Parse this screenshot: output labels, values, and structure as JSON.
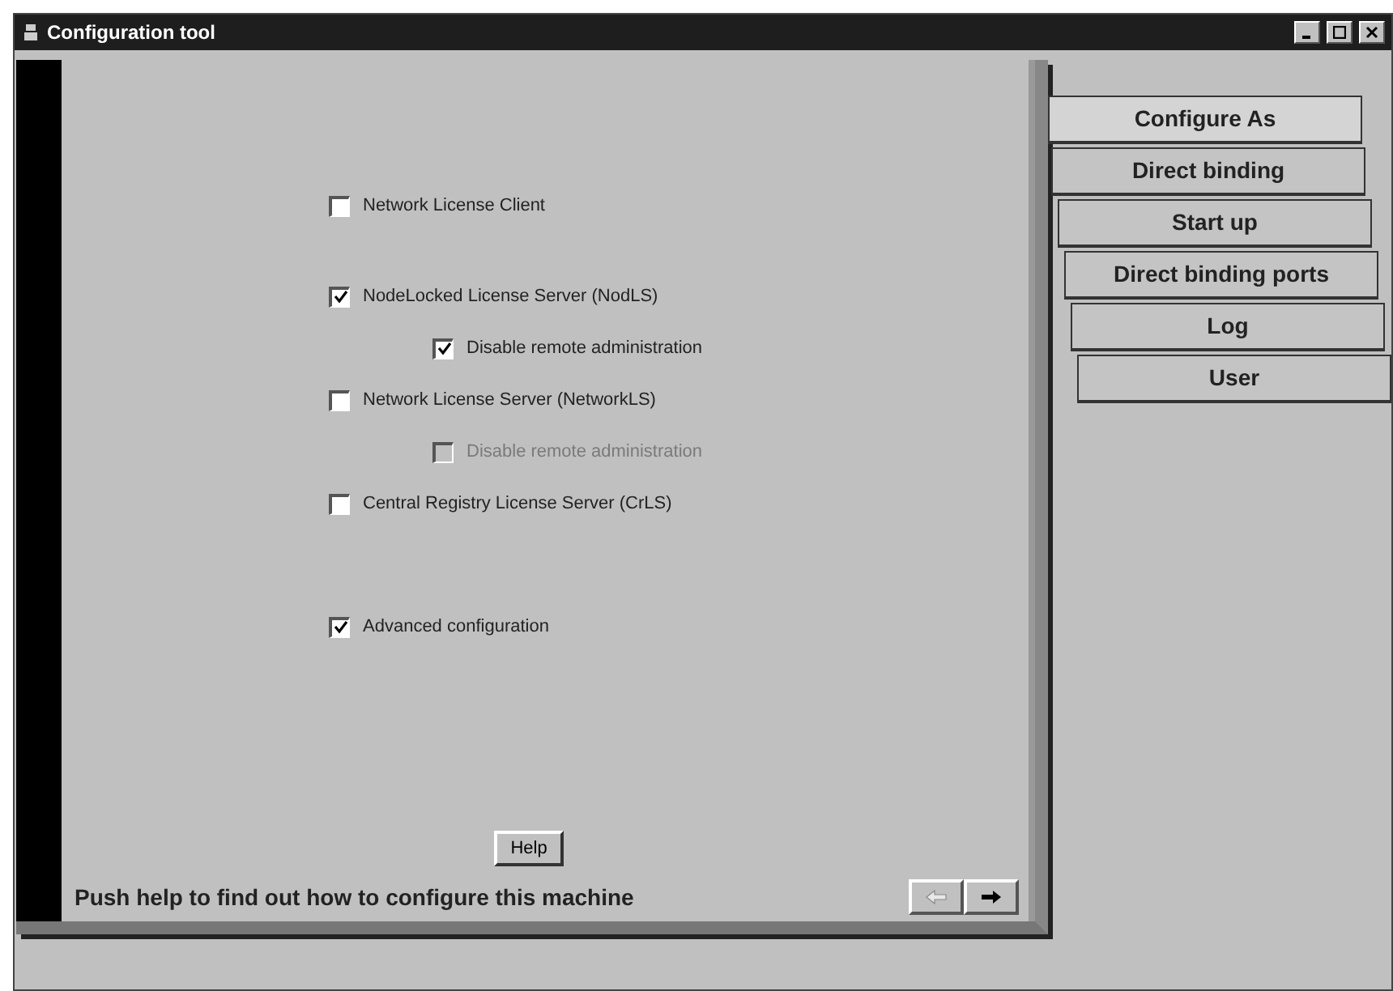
{
  "window": {
    "title": "Configuration tool"
  },
  "options": [
    {
      "label": "Network License Client",
      "checked": false,
      "disabled": false
    },
    {
      "label": "NodeLocked License Server (NodLS)",
      "checked": true,
      "disabled": false,
      "children": [
        {
          "label": "Disable remote administration",
          "checked": true,
          "disabled": false
        }
      ]
    },
    {
      "label": "Network License Server (NetworkLS)",
      "checked": false,
      "disabled": false,
      "children": [
        {
          "label": "Disable remote administration",
          "checked": false,
          "disabled": true
        }
      ]
    },
    {
      "label": "Central Registry License Server (CrLS)",
      "checked": false,
      "disabled": false
    },
    {
      "label": "Advanced configuration",
      "checked": true,
      "disabled": false
    }
  ],
  "help_button": "Help",
  "hint": "Push help to find out how to configure this machine",
  "nav": [
    {
      "kind": "back",
      "disabled": true
    },
    {
      "kind": "forward",
      "disabled": false
    }
  ],
  "tabs": [
    {
      "label": "Configure As",
      "selected": true
    },
    {
      "label": "Direct binding",
      "selected": false
    },
    {
      "label": "Start up",
      "selected": false
    },
    {
      "label": "Direct binding ports",
      "selected": false
    },
    {
      "label": "Log",
      "selected": false
    },
    {
      "label": "User",
      "selected": false
    }
  ]
}
